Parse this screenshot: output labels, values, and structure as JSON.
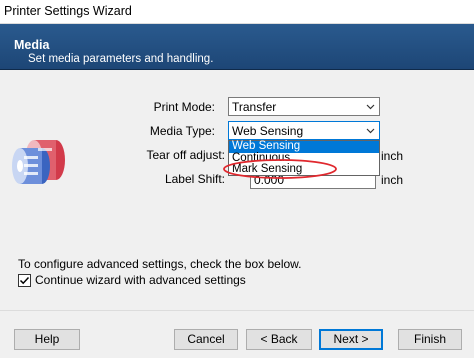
{
  "window": {
    "title": "Printer Settings Wizard"
  },
  "header": {
    "title": "Media",
    "subtitle": "Set media parameters and handling."
  },
  "form": {
    "print_mode_label": "Print Mode:",
    "print_mode_value": "Transfer",
    "media_type_label": "Media Type:",
    "media_type_value": "Web Sensing",
    "tear_off_label": "Tear off adjust:",
    "tear_off_unit": "inch",
    "label_shift_label": "Label Shift:",
    "label_shift_value": "0.000",
    "label_shift_unit": "inch"
  },
  "media_type_dropdown": {
    "options": [
      "Web Sensing",
      "Continuous",
      "Mark Sensing"
    ],
    "selected": "Web Sensing",
    "highlighted_option": "Mark Sensing"
  },
  "advanced": {
    "hint": "To configure advanced settings, check the box below.",
    "checkbox_label": "Continue wizard with advanced settings",
    "checked": true
  },
  "buttons": {
    "help": "Help",
    "cancel": "Cancel",
    "back": "< Back",
    "next": "Next >",
    "finish": "Finish"
  },
  "colors": {
    "header_bg": "#1d4676",
    "selection": "#0078d7",
    "annotation": "#e0282e"
  }
}
